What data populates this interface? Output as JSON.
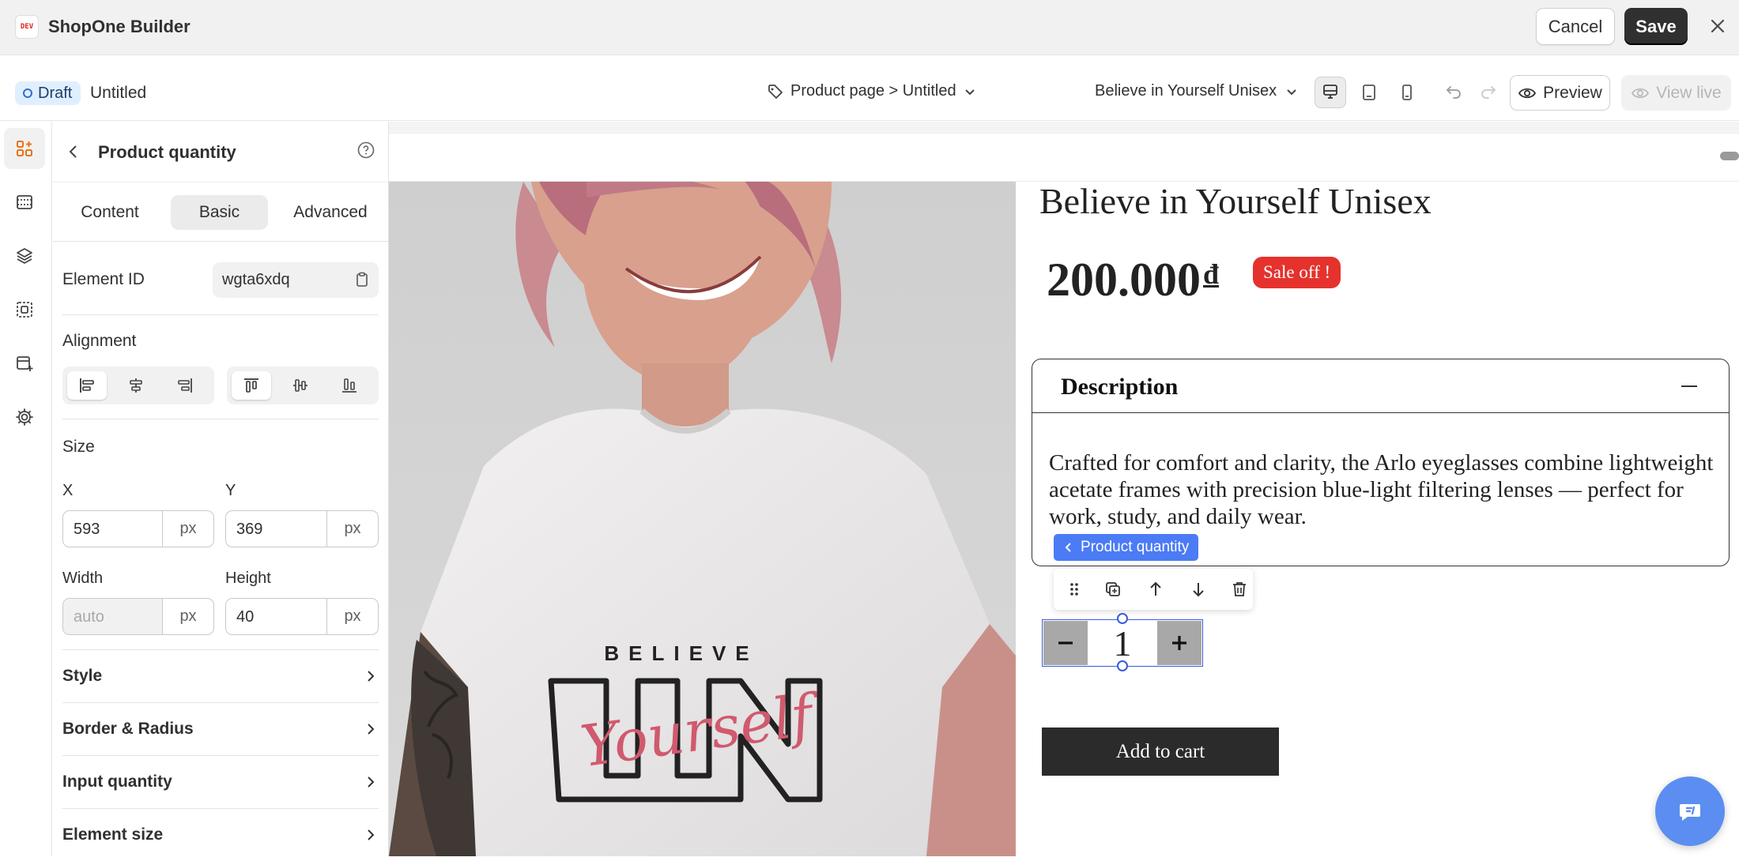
{
  "app": {
    "logo_text": "DEV",
    "title": "ShopOne Builder",
    "cancel_label": "Cancel",
    "save_label": "Save"
  },
  "subbar": {
    "status": "Draft",
    "page_name": "Untitled",
    "page_selector": "Product page > Untitled",
    "product_selector": "Believe in Yourself Unisex",
    "preview_label": "Preview",
    "view_live_label": "View live"
  },
  "panel": {
    "title": "Product quantity",
    "tabs": [
      "Content",
      "Basic",
      "Advanced"
    ],
    "active_tab": "Basic",
    "element_id_label": "Element ID",
    "element_id_value": "wgta6xdq",
    "alignment_label": "Alignment",
    "size_label": "Size",
    "x_label": "X",
    "x_value": "593",
    "y_label": "Y",
    "y_value": "369",
    "width_label": "Width",
    "width_value": "auto",
    "height_label": "Height",
    "height_value": "40",
    "unit": "px",
    "sections": [
      "Style",
      "Border & Radius",
      "Input quantity",
      "Element size"
    ]
  },
  "canvas": {
    "product_title": "Believe in Yourself Unisex",
    "price": "200.000",
    "currency": "đ",
    "sale_badge": "Sale off !",
    "description_title": "Description",
    "description_text": "Crafted for comfort and clarity, the Arlo eyeglasses combine lightweight acetate frames with precision blue-light filtering lenses — perfect for work, study, and daily wear.",
    "selected_element_tag": "Product quantity",
    "quantity": "1",
    "add_to_cart": "Add to cart",
    "shirt_print_top": "BELIEVE",
    "shirt_print_script": "Yourself"
  },
  "colors": {
    "accent_orange": "#e8731a",
    "selection_blue": "#3b5bdb",
    "tag_blue": "#4b7bf5",
    "sale_red": "#e5322d",
    "save_dark": "#303030"
  }
}
